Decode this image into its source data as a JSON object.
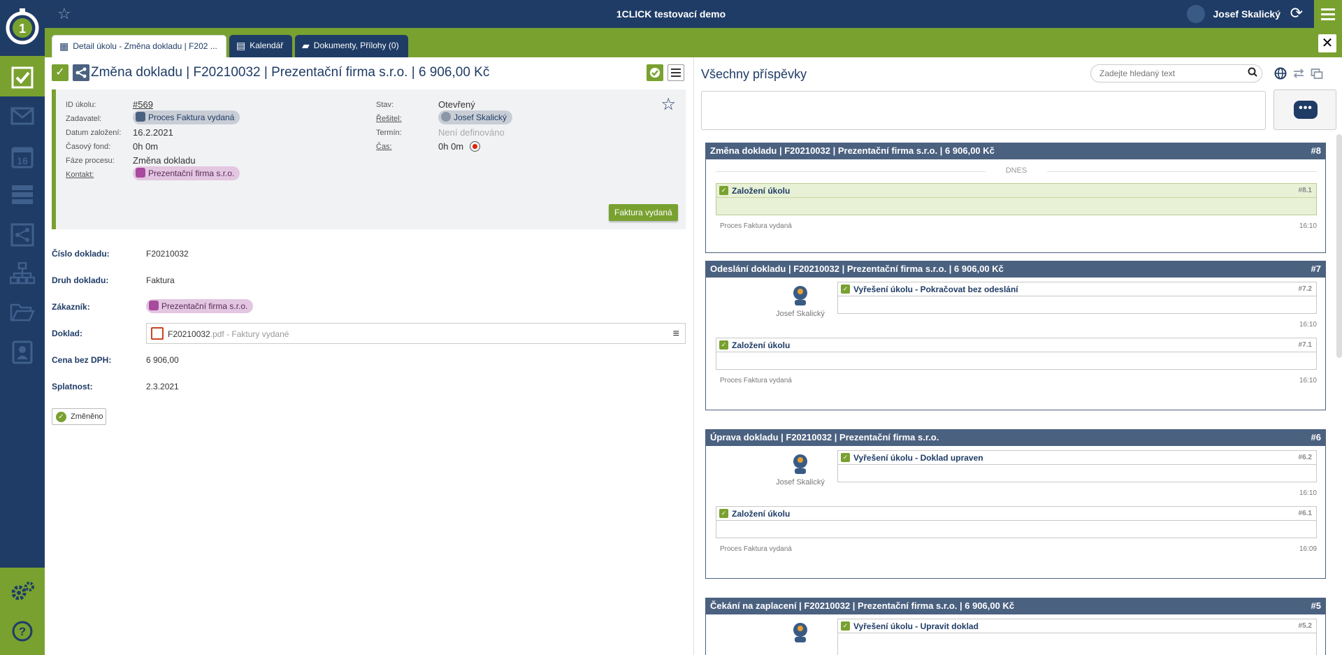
{
  "app": {
    "title": "1CLICK testovací demo",
    "user_name": "Josef Skalický"
  },
  "colors": {
    "navy": "#1f3c66",
    "green": "#79a130",
    "slate": "#4b6180"
  },
  "tabs": [
    {
      "label": "Detail úkolu - Změna dokladu | F202 ...",
      "icon": "grid-icon"
    },
    {
      "label": "Kalendář",
      "icon": "calendar-icon"
    },
    {
      "label": "Dokumenty, Přílohy (0)",
      "icon": "folder-icon"
    }
  ],
  "task": {
    "title": "Změna dokladu | F20210032 | Prezentační firma s.r.o. | 6 906,00 Kč",
    "info": {
      "id_label": "ID úkolu:",
      "id_value": "#569",
      "zadavatel_label": "Zadavatel:",
      "zadavatel_value": "Proces Faktura vydaná",
      "datum_label": "Datum založení:",
      "datum_value": "16.2.2021",
      "fond_label": "Časový fond:",
      "fond_value": "0h 0m",
      "faze_label": "Fáze procesu:",
      "faze_value": "Změna dokladu",
      "kontakt_label": "Kontakt:",
      "kontakt_value": "Prezentační firma s.r.o.",
      "stav_label": "Stav:",
      "stav_value": "Otevřený",
      "resitel_label": "Řešitel:",
      "resitel_value": "Josef Skalický",
      "termin_label": "Termín:",
      "termin_value": "Není definováno",
      "cas_label": "Čas:",
      "cas_value": "0h 0m",
      "action_button": "Faktura vydaná"
    },
    "fields": {
      "cislo_label": "Číslo dokladu:",
      "cislo_value": "F20210032",
      "druh_label": "Druh dokladu:",
      "druh_value": "Faktura",
      "zakaznik_label": "Zákazník:",
      "zakaznik_value": "Prezentační firma s.r.o.",
      "doklad_label": "Doklad:",
      "doklad_name": "F20210032",
      "doklad_suffix": ".pdf - Faktury vydané",
      "cena_label": "Cena bez DPH:",
      "cena_value": "6 906,00",
      "splatnost_label": "Splatnost:",
      "splatnost_value": "2.3.2021"
    },
    "changed_button": "Změněno"
  },
  "posts": {
    "title": "Všechny příspěvky",
    "search_placeholder": "Zadejte hledaný text",
    "today_label": "DNES",
    "groups": [
      {
        "title": "Změna dokladu | F20210032 | Prezentační firma s.r.o. | 6 906,00 Kč",
        "num": "#8",
        "entries": [
          {
            "title": "Založení úkolu",
            "num": "#8.1",
            "source": "Proces Faktura vydaná",
            "time": "16:10"
          }
        ]
      },
      {
        "title": "Odeslání dokladu | F20210032 | Prezentační firma s.r.o. | 6 906,00 Kč",
        "num": "#7",
        "entries": [
          {
            "title": "Vyřešení úkolu - Pokračovat bez odeslání",
            "num": "#7.2",
            "author": "Josef Skalický",
            "time": "16:10"
          },
          {
            "title": "Založení úkolu",
            "num": "#7.1",
            "source": "Proces Faktura vydaná",
            "time": "16:10"
          }
        ]
      },
      {
        "title": "Úprava dokladu | F20210032 | Prezentační firma s.r.o.",
        "num": "#6",
        "entries": [
          {
            "title": "Vyřešení úkolu - Doklad upraven",
            "num": "#6.2",
            "author": "Josef Skalický",
            "time": "16:10"
          },
          {
            "title": "Založení úkolu",
            "num": "#6.1",
            "source": "Proces Faktura vydaná",
            "time": "16:09"
          }
        ]
      },
      {
        "title": "Čekání na zaplacení | F20210032 | Prezentační firma s.r.o. | 6 906,00 Kč",
        "num": "#5",
        "entries": [
          {
            "title": "Vyřešení úkolu - Upravit doklad",
            "num": "#5.2"
          }
        ]
      }
    ]
  }
}
